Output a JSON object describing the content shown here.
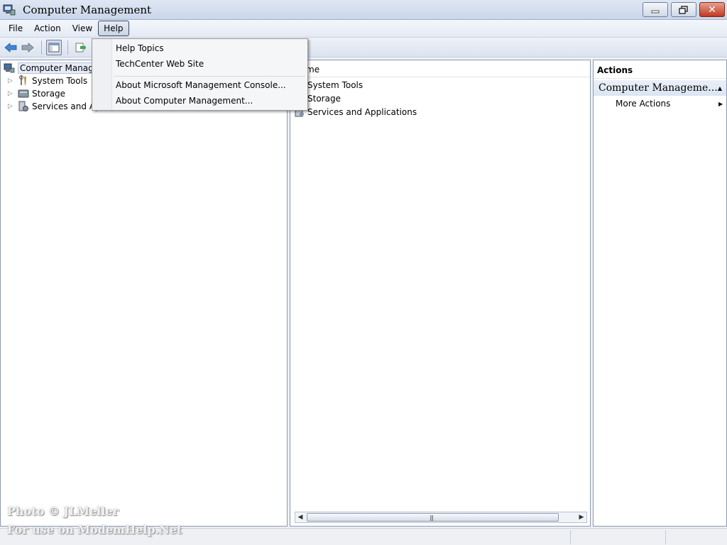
{
  "window": {
    "title": "Computer Management"
  },
  "menubar": {
    "items": [
      "File",
      "Action",
      "View",
      "Help"
    ],
    "active": "Help"
  },
  "help_menu": {
    "items": [
      "Help Topics",
      "TechCenter Web Site",
      "About Microsoft Management Console...",
      "About Computer Management..."
    ]
  },
  "tree": {
    "root": "Computer Manager",
    "children": [
      "System Tools",
      "Storage",
      "Services and Ap"
    ]
  },
  "list": {
    "column_header": "me",
    "rows": [
      "System Tools",
      "Storage",
      "Services and Applications"
    ]
  },
  "actions": {
    "header": "Actions",
    "group": "Computer Manageme...",
    "more": "More Actions"
  },
  "watermark": {
    "line1": "Photo © JLMeller",
    "line2": "For use on ModemHelp.Net"
  }
}
